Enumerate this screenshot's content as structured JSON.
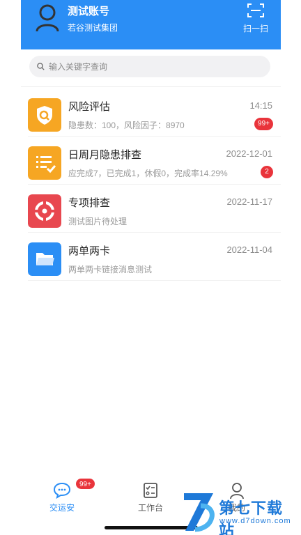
{
  "header": {
    "account_name": "测试账号",
    "org_name": "若谷测试集团",
    "scan_label": "扫一扫"
  },
  "search": {
    "placeholder": "输入关键字查询"
  },
  "list": [
    {
      "title": "风险评估",
      "subtitle": "隐患数：100，风险因子：8970",
      "time": "14:15",
      "badge": "99+",
      "icon": "shield-search-icon",
      "color": "#f6a623"
    },
    {
      "title": "日周月隐患排查",
      "subtitle": "应完成7，已完成1，休假0，完成率14.29%",
      "time": "2022-12-01",
      "badge": "2",
      "icon": "checklist-icon",
      "color": "#f6a623"
    },
    {
      "title": "专项排查",
      "subtitle": "测试图片待处理",
      "time": "2022-11-17",
      "badge": "",
      "icon": "target-icon",
      "color": "#e8474f"
    },
    {
      "title": "两单两卡",
      "subtitle": "两单两卡链接消息测试",
      "time": "2022-11-04",
      "badge": "",
      "icon": "folder-icon",
      "color": "#2b8ef5"
    }
  ],
  "tabbar": {
    "tabs": [
      {
        "label": "交运安",
        "badge": "99+",
        "icon": "chat-icon",
        "active": true
      },
      {
        "label": "工作台",
        "icon": "clipboard-icon",
        "active": false
      },
      {
        "label": "我的",
        "icon": "person-icon",
        "active": false
      }
    ]
  },
  "watermark": {
    "name": "第七下载站",
    "url": "www.d7down.com"
  },
  "colors": {
    "primary": "#2b8ef5",
    "badge": "#e9343b",
    "active_tab": "#2b8ef5"
  }
}
